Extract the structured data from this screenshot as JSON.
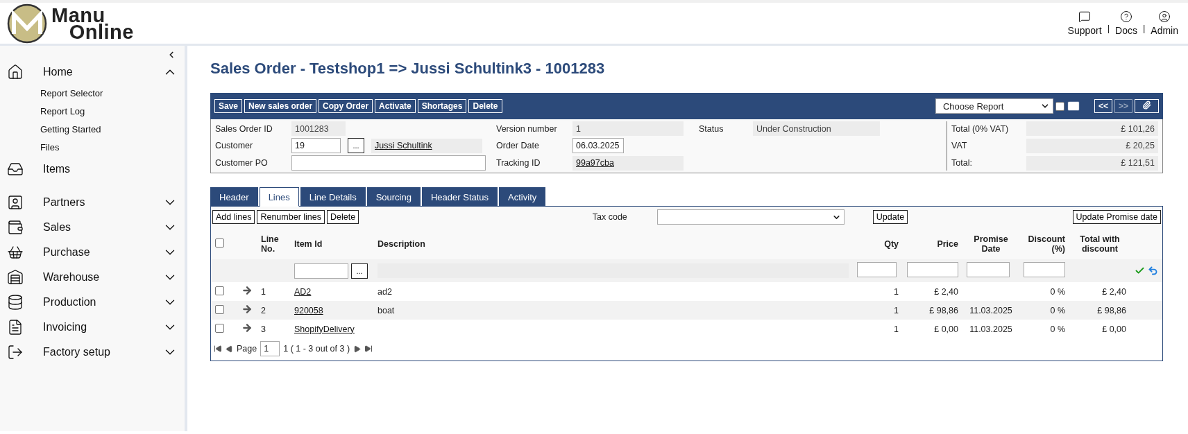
{
  "brand": {
    "line1": "Manu",
    "line2": "Online"
  },
  "top_links": [
    {
      "label": "Support"
    },
    {
      "label": "Docs"
    },
    {
      "label": "Admin"
    }
  ],
  "top_separator": "|",
  "sidebar": {
    "items": [
      {
        "label": "Home",
        "kind": "group",
        "expanded": true,
        "children": [
          {
            "label": "Report Selector"
          },
          {
            "label": "Report Log"
          },
          {
            "label": "Getting Started"
          },
          {
            "label": "Files"
          }
        ]
      },
      {
        "label": "Items",
        "kind": "link"
      },
      {
        "label": "Partners",
        "kind": "group",
        "expanded": false
      },
      {
        "label": "Sales",
        "kind": "group",
        "expanded": false
      },
      {
        "label": "Purchase",
        "kind": "group",
        "expanded": false
      },
      {
        "label": "Warehouse",
        "kind": "group",
        "expanded": false
      },
      {
        "label": "Production",
        "kind": "group",
        "expanded": false
      },
      {
        "label": "Invoicing",
        "kind": "group",
        "expanded": false
      },
      {
        "label": "Factory setup",
        "kind": "group",
        "expanded": false
      }
    ]
  },
  "page_title": "Sales Order - Testshop1 => Jussi Schultink3 - 1001283",
  "toolbar": {
    "buttons": [
      "Save",
      "New sales order",
      "Copy Order",
      "Activate",
      "Shortages",
      "Delete"
    ],
    "report_select": "Choose Report",
    "email_checked": false,
    "nav_buttons": [
      {
        "label": "<<",
        "disabled": false
      },
      {
        "label": ">>",
        "disabled": true
      }
    ]
  },
  "form": {
    "sales_order_id": {
      "label": "Sales Order ID",
      "value": "1001283"
    },
    "customer": {
      "label": "Customer",
      "value": "19",
      "lookup": "...",
      "name": "Jussi Schultink"
    },
    "customer_po": {
      "label": "Customer PO"
    },
    "version": {
      "label": "Version number",
      "value": "1"
    },
    "order_date": {
      "label": "Order Date",
      "value": "06.03.2025"
    },
    "tracking": {
      "label": "Tracking ID",
      "value": "99a97cba"
    },
    "status": {
      "label": "Status",
      "value": "Under Construction"
    },
    "totals": [
      {
        "label": "Total (0% VAT)",
        "value": "£ 101,26"
      },
      {
        "label": "VAT",
        "value": "£ 20,25"
      },
      {
        "label": "Total:",
        "value": "£ 121,51"
      }
    ]
  },
  "tabs": [
    {
      "label": "Header",
      "selected": false
    },
    {
      "label": "Lines",
      "selected": true
    },
    {
      "label": "Line Details",
      "selected": false
    },
    {
      "label": "Sourcing",
      "selected": false
    },
    {
      "label": "Header Status",
      "selected": false
    },
    {
      "label": "Activity",
      "selected": false
    }
  ],
  "lines": {
    "buttons": [
      "Add lines",
      "Renumber lines",
      "Delete"
    ],
    "tax_code_label": "Tax code",
    "update": "Update",
    "update_promise": "Update Promise date",
    "select_all_checked": false,
    "columns": [
      "Line No.",
      "Item Id",
      "Description",
      "Qty",
      "Price",
      "Promise Date",
      "Discount (%)",
      "Total with discount"
    ],
    "new_row_lookup": "...",
    "rows": [
      {
        "checked": false,
        "line": "1",
        "item": "AD2",
        "description": "ad2",
        "qty": "1",
        "price": "£ 2,40",
        "promise": "",
        "discount": "0 %",
        "total": "£ 2,40"
      },
      {
        "checked": false,
        "line": "2",
        "item": "920058",
        "description": "boat",
        "qty": "1",
        "price": "£ 98,86",
        "promise": "11.03.2025",
        "discount": "0 %",
        "total": "£ 98,86"
      },
      {
        "checked": false,
        "line": "3",
        "item": "ShopifyDelivery",
        "description": "",
        "qty": "1",
        "price": "£ 0,00",
        "promise": "11.03.2025",
        "discount": "0 %",
        "total": "£ 0,00"
      }
    ],
    "pager": {
      "label": "Page",
      "page": "1",
      "summary": "1 ( 1 - 3 out of 3 )"
    }
  }
}
